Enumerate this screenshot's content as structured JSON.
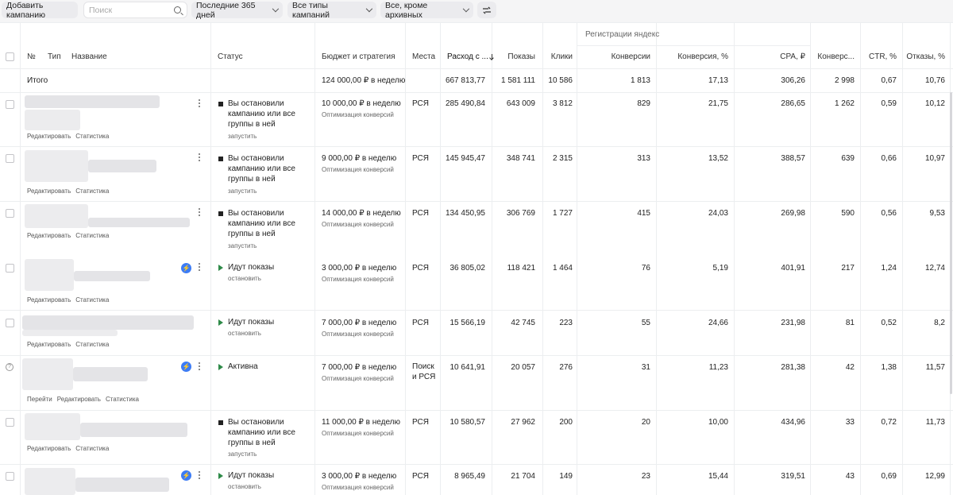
{
  "toolbar": {
    "add_campaign": "Добавить кампанию",
    "search_placeholder": "Поиск",
    "period": "Последние 365 дней",
    "types": "Все типы кампаний",
    "status_filter": "Все, кроме архивных"
  },
  "header": {
    "group_label": "Регистрации яндекс",
    "num": "№",
    "type": "Тип",
    "name": "Название",
    "status": "Статус",
    "budget": "Бюджет и стратегия",
    "places": "Места",
    "spend": "Расход с ...",
    "impressions": "Показы",
    "clicks": "Клики",
    "conversions": "Конверсии",
    "conversion_rate": "Конверсия, %",
    "cpa": "CPA, ₽",
    "conversions2": "Конверс...",
    "ctr": "CTR, %",
    "bounces": "Отказы, %"
  },
  "total": {
    "label": "Итого",
    "budget": "124 000,00 ₽ в неделю",
    "spend": "667 813,77",
    "impressions": "1 581 111",
    "clicks": "10 586",
    "conversions": "1 813",
    "conversion_rate": "17,13",
    "cpa": "306,26",
    "conversions2": "2 998",
    "ctr": "0,67",
    "bounces": "10,76"
  },
  "links": {
    "edit": "Редактировать",
    "stats": "Статистика",
    "open": "Перейти"
  },
  "rows": [
    {
      "status": "Вы остановили кампанию или все группы в ней",
      "action": "запустить",
      "budget": "10 000,00 ₽ в неделю",
      "strategy": "Оптимизация конверсий",
      "places": "РСЯ",
      "spend": "285 490,84",
      "impressions": "643 009",
      "clicks": "3 812",
      "conversions": "829",
      "conversion_rate": "21,75",
      "cpa": "286,65",
      "conversions2": "1 262",
      "ctr": "0,59",
      "bounces": "10,12"
    },
    {
      "status": "Вы остановили кампанию или все группы в ней",
      "action": "запустить",
      "budget": "9 000,00 ₽ в неделю",
      "strategy": "Оптимизация конверсий",
      "places": "РСЯ",
      "spend": "145 945,47",
      "impressions": "348 741",
      "clicks": "2 315",
      "conversions": "313",
      "conversion_rate": "13,52",
      "cpa": "388,57",
      "conversions2": "639",
      "ctr": "0,66",
      "bounces": "10,97"
    },
    {
      "status": "Вы остановили кампанию или все группы в ней",
      "action": "запустить",
      "budget": "14 000,00 ₽ в неделю",
      "strategy": "Оптимизация конверсий",
      "places": "РСЯ",
      "spend": "134 450,95",
      "impressions": "306 769",
      "clicks": "1 727",
      "conversions": "415",
      "conversion_rate": "24,03",
      "cpa": "269,98",
      "conversions2": "590",
      "ctr": "0,56",
      "bounces": "9,53"
    },
    {
      "status": "Идут показы",
      "action": "остановить",
      "budget": "3 000,00 ₽ в неделю",
      "strategy": "Оптимизация конверсий",
      "places": "РСЯ",
      "spend": "36 805,02",
      "impressions": "118 421",
      "clicks": "1 464",
      "conversions": "76",
      "conversion_rate": "5,19",
      "cpa": "401,91",
      "conversions2": "217",
      "ctr": "1,24",
      "bounces": "12,74"
    },
    {
      "status": "Идут показы",
      "action": "остановить",
      "budget": "7 000,00 ₽ в неделю",
      "strategy": "Оптимизация конверсий",
      "places": "РСЯ",
      "spend": "15 566,19",
      "impressions": "42 745",
      "clicks": "223",
      "conversions": "55",
      "conversion_rate": "24,66",
      "cpa": "231,98",
      "conversions2": "81",
      "ctr": "0,52",
      "bounces": "8,2"
    },
    {
      "status": "Активна",
      "action": "",
      "budget": "7 000,00 ₽ в неделю",
      "strategy": "Оптимизация конверсий",
      "places": "Поиск и РСЯ",
      "spend": "10 641,91",
      "impressions": "20 057",
      "clicks": "276",
      "conversions": "31",
      "conversion_rate": "11,23",
      "cpa": "281,38",
      "conversions2": "42",
      "ctr": "1,38",
      "bounces": "11,57"
    },
    {
      "status": "Вы остановили кампанию или все группы в ней",
      "action": "запустить",
      "budget": "11 000,00 ₽ в неделю",
      "strategy": "Оптимизация конверсий",
      "places": "РСЯ",
      "spend": "10 580,57",
      "impressions": "27 962",
      "clicks": "200",
      "conversions": "20",
      "conversion_rate": "10,00",
      "cpa": "434,96",
      "conversions2": "33",
      "ctr": "0,72",
      "bounces": "11,73"
    },
    {
      "status": "Идут показы",
      "action": "остановить",
      "budget": "3 000,00 ₽ в неделю",
      "strategy": "Оптимизация конверсий",
      "places": "РСЯ",
      "spend": "8 965,49",
      "impressions": "21 704",
      "clicks": "149",
      "conversions": "23",
      "conversion_rate": "15,44",
      "cpa": "319,51",
      "conversions2": "43",
      "ctr": "0,69",
      "bounces": "12,99"
    }
  ]
}
